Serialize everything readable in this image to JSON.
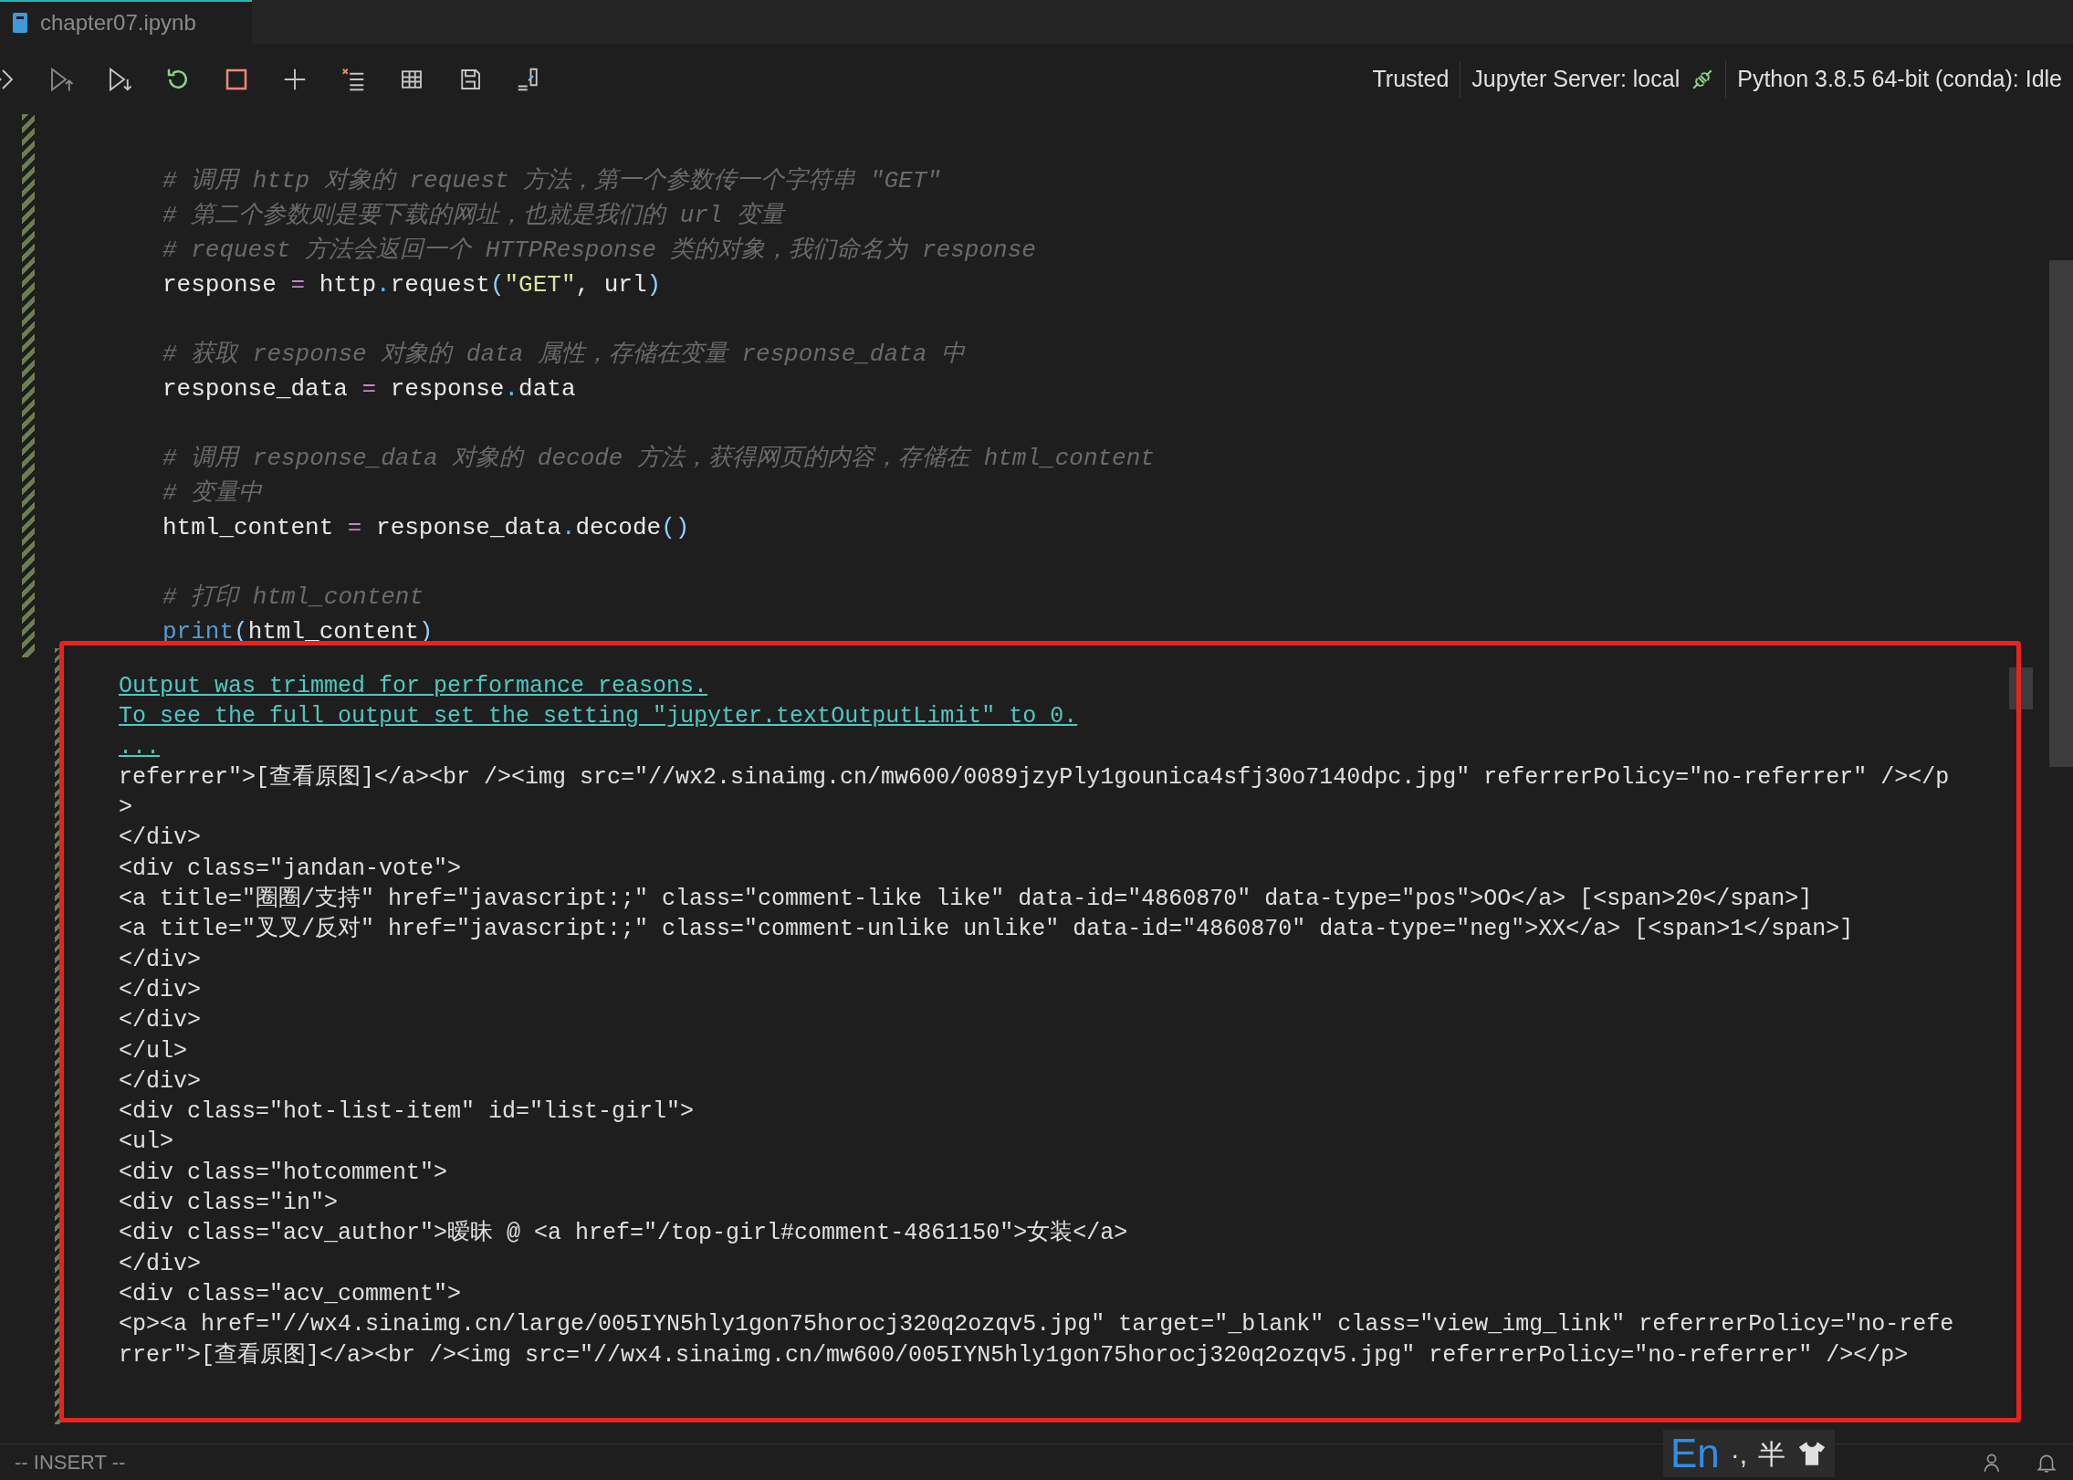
{
  "tab": {
    "title": "chapter07.ipynb",
    "selected": true
  },
  "toolbar_status": {
    "trusted": "Trusted",
    "server": "Jupyter Server: local",
    "kernel": "Python 3.8.5 64-bit (conda): Idle"
  },
  "code_cell": {
    "lines": [
      {
        "kind": "comment",
        "text": "# 调用 http 对象的 request 方法，第一个参数传一个字符串 \"GET\""
      },
      {
        "kind": "comment",
        "text": "# 第二个参数则是要下载的网址，也就是我们的 url 变量"
      },
      {
        "kind": "comment",
        "text": "# request 方法会返回一个 HTTPResponse 类的对象，我们命名为 response"
      },
      {
        "kind": "code",
        "tokens": [
          {
            "kind": "name",
            "text": "response "
          },
          {
            "kind": "op",
            "text": "="
          },
          {
            "kind": "name",
            "text": " http"
          },
          {
            "kind": "dot",
            "text": "."
          },
          {
            "kind": "name",
            "text": "request"
          },
          {
            "kind": "paren",
            "text": "("
          },
          {
            "kind": "string",
            "text": "\"GET\""
          },
          {
            "kind": "name",
            "text": ", url"
          },
          {
            "kind": "paren",
            "text": ")"
          }
        ]
      },
      {
        "kind": "blank"
      },
      {
        "kind": "comment",
        "text": "# 获取 response 对象的 data 属性，存储在变量 response_data 中"
      },
      {
        "kind": "code",
        "tokens": [
          {
            "kind": "name",
            "text": "response_data "
          },
          {
            "kind": "op",
            "text": "="
          },
          {
            "kind": "name",
            "text": " response"
          },
          {
            "kind": "dot",
            "text": "."
          },
          {
            "kind": "name",
            "text": "data"
          }
        ]
      },
      {
        "kind": "blank"
      },
      {
        "kind": "comment",
        "text": "# 调用 response_data 对象的 decode 方法，获得网页的内容，存储在 html_content"
      },
      {
        "kind": "comment",
        "text": "# 变量中"
      },
      {
        "kind": "code",
        "tokens": [
          {
            "kind": "name",
            "text": "html_content "
          },
          {
            "kind": "op",
            "text": "="
          },
          {
            "kind": "name",
            "text": " response_data"
          },
          {
            "kind": "dot",
            "text": "."
          },
          {
            "kind": "name",
            "text": "decode"
          },
          {
            "kind": "paren",
            "text": "()"
          }
        ]
      },
      {
        "kind": "blank"
      },
      {
        "kind": "comment",
        "text": "# 打印 html_content"
      },
      {
        "kind": "code",
        "tokens": [
          {
            "kind": "func",
            "text": "print"
          },
          {
            "kind": "paren",
            "text": "("
          },
          {
            "kind": "name",
            "text": "html_content"
          },
          {
            "kind": "paren",
            "text": ")"
          }
        ]
      }
    ]
  },
  "output": {
    "notices": [
      "Output was trimmed for performance reasons.",
      "To see the full output set the setting \"jupyter.textOutputLimit\" to 0.",
      "..."
    ],
    "lines": [
      "referrer\">[查看原图]</a><br /><img src=\"//wx2.sinaimg.cn/mw600/0089jzyPly1gounica4sfj30o7140dpc.jpg\" referrerPolicy=\"no-referrer\" /></p",
      ">",
      "</div>",
      "<div class=\"jandan-vote\">",
      "<a title=\"圈圈/支持\" href=\"javascript:;\" class=\"comment-like like\" data-id=\"4860870\" data-type=\"pos\">OO</a> [<span>20</span>]",
      "<a title=\"叉叉/反对\" href=\"javascript:;\" class=\"comment-unlike unlike\" data-id=\"4860870\" data-type=\"neg\">XX</a> [<span>1</span>]",
      "</div>",
      "</div>",
      "</div>",
      "</ul>",
      "</div>",
      "<div class=\"hot-list-item\" id=\"list-girl\">",
      "<ul>",
      "<div class=\"hotcomment\">",
      "<div class=\"in\">",
      "<div class=\"acv_author\">暧昧 @ <a href=\"/top-girl#comment-4861150\">女装</a>",
      "</div>",
      "<div class=\"acv_comment\">",
      "<p><a href=\"//wx4.sinaimg.cn/large/005IYN5hly1gon75horocj320q2ozqv5.jpg\" target=\"_blank\" class=\"view_img_link\" referrerPolicy=\"no-refe",
      "rrer\">[查看原图]</a><br /><img src=\"//wx4.sinaimg.cn/mw600/005IYN5hly1gon75horocj320q2ozqv5.jpg\" referrerPolicy=\"no-referrer\" /></p>"
    ]
  },
  "status_bar": {
    "mode": "-- INSERT --"
  },
  "ime": {
    "language": "En",
    "punctuation": "·,",
    "width": "半"
  }
}
